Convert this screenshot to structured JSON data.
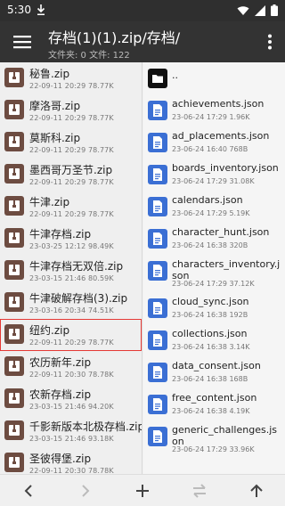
{
  "status": {
    "time": "5:30"
  },
  "appbar": {
    "title": "存档(1)(1).zip/存档/",
    "subtitle": "文件夹: 0  文件: 122"
  },
  "left_pane": {
    "items": [
      {
        "name": "秘鲁.zip",
        "meta": "22-09-11 20:29  78.77K",
        "selected": false
      },
      {
        "name": "摩洛哥.zip",
        "meta": "22-09-11 20:29  78.77K",
        "selected": false
      },
      {
        "name": "莫斯科.zip",
        "meta": "22-09-11 20:29  78.77K",
        "selected": false
      },
      {
        "name": "墨西哥万圣节.zip",
        "meta": "22-09-11 20:29  78.77K",
        "selected": false
      },
      {
        "name": "牛津.zip",
        "meta": "22-09-11 20:29  78.77K",
        "selected": false
      },
      {
        "name": "牛津存档.zip",
        "meta": "23-03-25 12:12  98.49K",
        "selected": false
      },
      {
        "name": "牛津存档无双倍.zip",
        "meta": "23-03-15 21:46  80.59K",
        "selected": false
      },
      {
        "name": "牛津破解存档(3).zip",
        "meta": "23-03-16 20:34  74.51K",
        "selected": false
      },
      {
        "name": "纽约.zip",
        "meta": "22-09-11 20:29  78.77K",
        "selected": true
      },
      {
        "name": "农历新年.zip",
        "meta": "22-09-11 20:30  78.78K",
        "selected": false
      },
      {
        "name": "农新存档.zip",
        "meta": "23-03-15 21:46  94.20K",
        "selected": false
      },
      {
        "name": "千影新版本北极存档.zip",
        "meta": "23-03-15 21:46  93.18K",
        "selected": false
      },
      {
        "name": "圣彼得堡.zip",
        "meta": "22-09-11 20:30  78.78K",
        "selected": false
      }
    ]
  },
  "right_pane": {
    "up_label": "..",
    "items": [
      {
        "name": "achievements.json",
        "meta": "23-06-24 17:29  1.96K",
        "tall": false
      },
      {
        "name": "ad_placements.json",
        "meta": "23-06-24 16:40  768B",
        "tall": false
      },
      {
        "name": "boards_inventory.json",
        "meta": "23-06-24 17:29  31.08K",
        "tall": false
      },
      {
        "name": "calendars.json",
        "meta": "23-06-24 17:29  5.19K",
        "tall": false
      },
      {
        "name": "character_hunt.json",
        "meta": "23-06-24 16:38  320B",
        "tall": false
      },
      {
        "name": "characters_inventory.json",
        "meta": "23-06-24 17:29  37.12K",
        "tall": true
      },
      {
        "name": "cloud_sync.json",
        "meta": "23-06-24 16:38  192B",
        "tall": false
      },
      {
        "name": "collections.json",
        "meta": "23-06-24 16:38  3.14K",
        "tall": false
      },
      {
        "name": "data_consent.json",
        "meta": "23-06-24 16:38  168B",
        "tall": false
      },
      {
        "name": "free_content.json",
        "meta": "23-06-24 16:38  4.19K",
        "tall": false
      },
      {
        "name": "generic_challenges.json",
        "meta": "23-06-24 17:29  33.96K",
        "tall": true
      }
    ]
  },
  "bottombar": {
    "icons": [
      "back-arrow-icon",
      "forward-arrow-icon",
      "add-icon",
      "swap-icon",
      "up-arrow-icon"
    ]
  },
  "colors": {
    "zip_icon": "#6d4c41",
    "doc_icon": "#3b6fd4",
    "appbar": "#333333",
    "selected_border": "#e53935"
  }
}
